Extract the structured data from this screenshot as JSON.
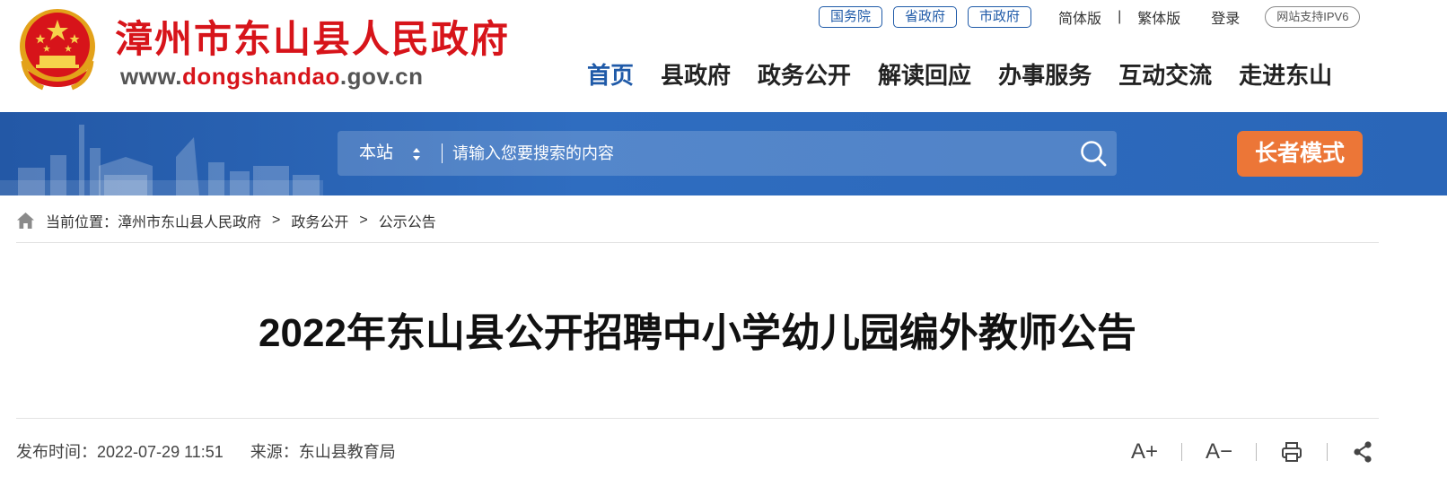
{
  "header": {
    "site_title": "漳州市东山县人民政府",
    "url_prefix": "www.",
    "url_highlight": "dongshandao",
    "url_suffix": ".gov.cn",
    "gov_links": [
      "国务院",
      "省政府",
      "市政府"
    ],
    "simplified": "简体版",
    "separator": "|",
    "traditional": "繁体版",
    "login": "登录",
    "ipv6_badge": "网站支持IPV6",
    "nav": [
      "首页",
      "县政府",
      "政务公开",
      "解读回应",
      "办事服务",
      "互动交流",
      "走进东山"
    ],
    "active_nav": "首页"
  },
  "banner": {
    "search_scope": "本站",
    "search_placeholder": "请输入您要搜索的内容",
    "elder_mode": "长者模式"
  },
  "breadcrumb": {
    "label": "当前位置：",
    "items": [
      "漳州市东山县人民政府",
      "政务公开",
      "公示公告"
    ],
    "separator": ">"
  },
  "article": {
    "title": "2022年东山县公开招聘中小学幼儿园编外教师公告",
    "publish_label": "发布时间：",
    "publish_time": "2022-07-29 11:51",
    "source_label": "来源：",
    "source": "东山县教育局"
  },
  "tools": {
    "font_increase": "A+",
    "font_decrease": "A−"
  },
  "icons": {
    "emblem": "national-emblem-icon",
    "search": "search-icon",
    "home": "home-icon",
    "print": "print-icon",
    "share": "share-icon"
  },
  "colors": {
    "brand_red": "#d7141a",
    "brand_blue": "#1f5aa8",
    "elder_orange": "#ec7637"
  }
}
